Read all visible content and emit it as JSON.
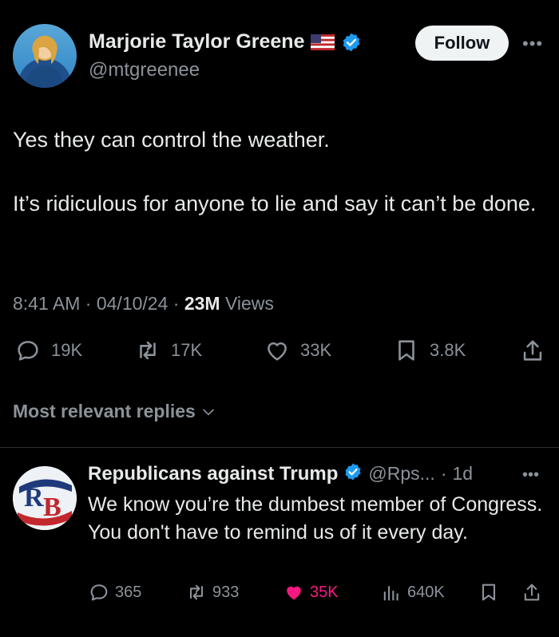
{
  "tweet": {
    "author_name": "Marjorie Taylor Greene",
    "author_handle": "@mtgreenee",
    "follow_label": "Follow",
    "text_lines": [
      "Yes they can control the weather.",
      "It’s ridiculous for anyone to lie and say it can’t be done."
    ],
    "time": "8:41 AM",
    "date": "04/10/24",
    "views_count": "23M",
    "views_label": "Views",
    "replies": "19K",
    "reposts": "17K",
    "likes": "33K",
    "bookmarks": "3.8K"
  },
  "sort": {
    "label": "Most relevant replies"
  },
  "reply": {
    "author_name": "Republicans against Trump",
    "author_handle": "@Rps...",
    "age": "1d",
    "text": "We know you’re the dumbest member of Congress. You don't have to remind us of it every day.",
    "replies": "365",
    "reposts": "933",
    "likes": "35K",
    "views": "640K"
  },
  "colors": {
    "background": "#000000",
    "muted": "#8b9299",
    "verified": "#1d9bf0",
    "like": "#f91880"
  },
  "icons": [
    "flag-us-icon",
    "verified-badge-icon",
    "more-icon",
    "reply-icon",
    "repost-icon",
    "like-icon",
    "bookmark-icon",
    "share-icon",
    "chevron-down-icon",
    "views-icon"
  ]
}
